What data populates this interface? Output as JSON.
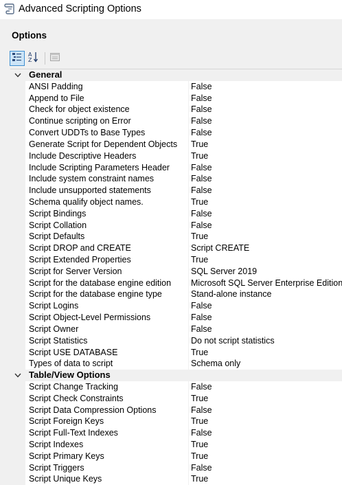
{
  "window": {
    "title": "Advanced Scripting Options",
    "icon": "scripting-wizard-icon"
  },
  "panel": {
    "heading": "Options"
  },
  "toolbar": {
    "buttons": [
      {
        "name": "categorized-view-button",
        "icon": "categorized-icon",
        "active": true
      },
      {
        "name": "alphabetical-sort-button",
        "icon": "sort-az-icon",
        "active": false
      },
      {
        "name": "property-pages-button",
        "icon": "property-pages-icon",
        "active": false,
        "disabled": true
      }
    ]
  },
  "categories": [
    {
      "label": "General",
      "expanded": true,
      "properties": [
        {
          "name": "ANSI Padding",
          "value": "False"
        },
        {
          "name": "Append to File",
          "value": "False"
        },
        {
          "name": "Check for object existence",
          "value": "False"
        },
        {
          "name": "Continue scripting on Error",
          "value": "False"
        },
        {
          "name": "Convert UDDTs to Base Types",
          "value": "False"
        },
        {
          "name": "Generate Script for Dependent Objects",
          "value": "True"
        },
        {
          "name": "Include Descriptive Headers",
          "value": "True"
        },
        {
          "name": "Include Scripting Parameters Header",
          "value": "False"
        },
        {
          "name": "Include system constraint names",
          "value": "False"
        },
        {
          "name": "Include unsupported statements",
          "value": "False"
        },
        {
          "name": "Schema qualify object names.",
          "value": "True"
        },
        {
          "name": "Script Bindings",
          "value": "False"
        },
        {
          "name": "Script Collation",
          "value": "False"
        },
        {
          "name": "Script Defaults",
          "value": "True"
        },
        {
          "name": "Script DROP and CREATE",
          "value": "Script CREATE"
        },
        {
          "name": "Script Extended Properties",
          "value": "True"
        },
        {
          "name": "Script for Server Version",
          "value": "SQL Server 2019"
        },
        {
          "name": "Script for the database engine edition",
          "value": "Microsoft SQL Server Enterprise Edition"
        },
        {
          "name": "Script for the database engine type",
          "value": "Stand-alone instance"
        },
        {
          "name": "Script Logins",
          "value": "False"
        },
        {
          "name": "Script Object-Level Permissions",
          "value": "False"
        },
        {
          "name": "Script Owner",
          "value": "False"
        },
        {
          "name": "Script Statistics",
          "value": "Do not script statistics"
        },
        {
          "name": "Script USE DATABASE",
          "value": "True"
        },
        {
          "name": "Types of data to script",
          "value": "Schema only"
        }
      ]
    },
    {
      "label": "Table/View Options",
      "expanded": true,
      "properties": [
        {
          "name": "Script Change Tracking",
          "value": "False"
        },
        {
          "name": "Script Check Constraints",
          "value": "True"
        },
        {
          "name": "Script Data Compression Options",
          "value": "False"
        },
        {
          "name": "Script Foreign Keys",
          "value": "True"
        },
        {
          "name": "Script Full-Text Indexes",
          "value": "False"
        },
        {
          "name": "Script Indexes",
          "value": "True"
        },
        {
          "name": "Script Primary Keys",
          "value": "True"
        },
        {
          "name": "Script Triggers",
          "value": "False"
        },
        {
          "name": "Script Unique Keys",
          "value": "True"
        }
      ]
    }
  ]
}
